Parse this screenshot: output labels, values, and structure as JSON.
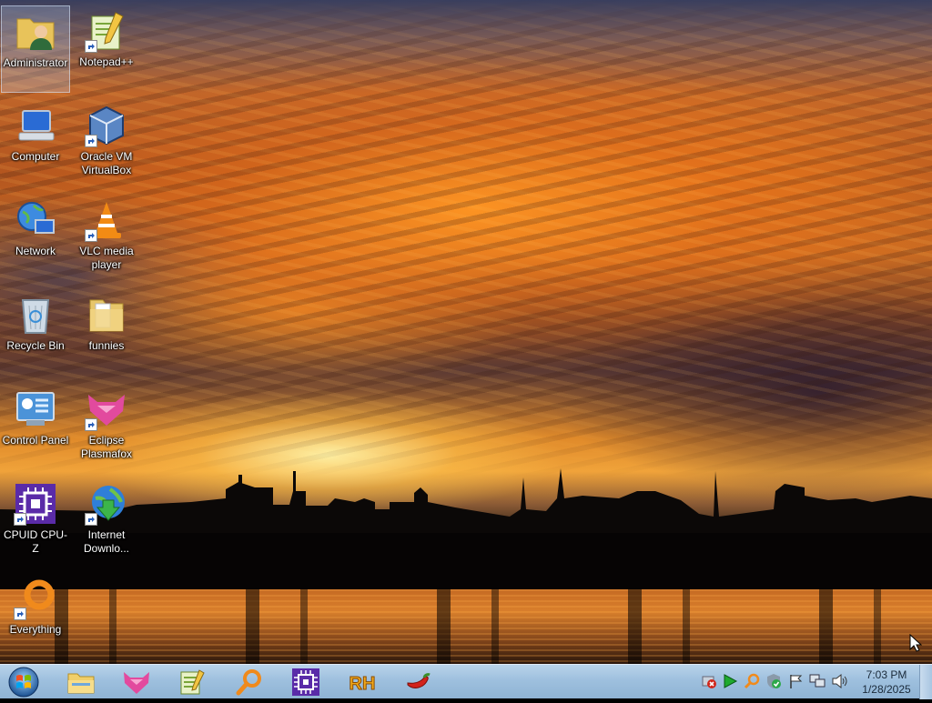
{
  "desktop": {
    "icons": [
      {
        "label": "Administrator",
        "icon": "user-folder-icon",
        "shortcut": false,
        "selected": true
      },
      {
        "label": "Notepad++",
        "icon": "notepadpp-icon",
        "shortcut": true
      },
      {
        "label": "Computer",
        "icon": "computer-icon",
        "shortcut": false
      },
      {
        "label": "Oracle VM\nVirtualBox",
        "icon": "virtualbox-icon",
        "shortcut": true
      },
      {
        "label": "Network",
        "icon": "network-globe-icon",
        "shortcut": false
      },
      {
        "label": "VLC media\nplayer",
        "icon": "vlc-cone-icon",
        "shortcut": true
      },
      {
        "label": "Recycle Bin",
        "icon": "recycle-bin-icon",
        "shortcut": false
      },
      {
        "label": "funnies",
        "icon": "folder-icon",
        "shortcut": false
      },
      {
        "label": "Control Panel",
        "icon": "control-panel-icon",
        "shortcut": false
      },
      {
        "label": "Eclipse\nPlasmafox",
        "icon": "plasmafox-icon",
        "shortcut": true
      },
      {
        "label": "CPUID CPU-Z",
        "icon": "cpuz-chip-icon",
        "shortcut": true
      },
      {
        "label": "Internet\nDownlo...",
        "icon": "idm-globe-icon",
        "shortcut": true
      },
      {
        "label": "Everything",
        "icon": "everything-ring-icon",
        "shortcut": true
      }
    ]
  },
  "taskbar": {
    "start": "windows-start-orb-icon",
    "pinned": [
      {
        "name": "Windows Explorer",
        "icon": "explorer-folder-icon"
      },
      {
        "name": "Eclipse Plasmafox",
        "icon": "plasmafox-icon"
      },
      {
        "name": "Notepad++",
        "icon": "notepadpp-icon"
      },
      {
        "name": "Everything",
        "icon": "search-magnifier-icon"
      },
      {
        "name": "CPUID CPU-Z",
        "icon": "cpuz-chip-icon"
      },
      {
        "name": "RH",
        "icon": "resource-hacker-icon",
        "text": "RH"
      },
      {
        "name": "Hot Pepper",
        "icon": "chili-pepper-icon"
      }
    ],
    "tray": [
      {
        "name": "network-error",
        "icon": "red-x-icon"
      },
      {
        "name": "play",
        "icon": "green-play-icon"
      },
      {
        "name": "search",
        "icon": "orange-search-icon"
      },
      {
        "name": "security",
        "icon": "shield-check-icon"
      },
      {
        "name": "action-center",
        "icon": "flag-icon"
      },
      {
        "name": "network",
        "icon": "network-monitor-icon"
      },
      {
        "name": "volume",
        "icon": "speaker-icon"
      }
    ],
    "clock": {
      "time": "7:03 PM",
      "date": "1/28/2025"
    }
  }
}
